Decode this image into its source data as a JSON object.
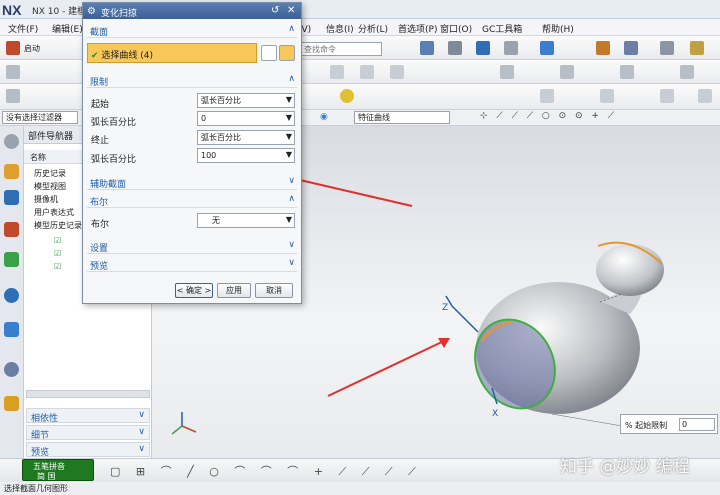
{
  "app": {
    "logo": "NX",
    "title": "NX 10 - 建模"
  },
  "menu": [
    "文件(F)",
    "编辑(E)",
    "视图(V)",
    "信息(I)",
    "分析(L)",
    "首选项(P)",
    "窗口(O)",
    "GC工具箱",
    "帮助(H)"
  ],
  "toolbar": {
    "start_label": "启动",
    "command_search_placeholder": "查找命令"
  },
  "filter": {
    "selection_filter": "没有选择过滤器",
    "curve_rule": "特征曲线"
  },
  "navigator": {
    "title": "部件导航器",
    "column": "名称",
    "rows": [
      "历史记录",
      "模型视图",
      "摄像机",
      "用户表达式",
      "模型历史记录"
    ],
    "sections": [
      "相依性",
      "细节",
      "预览"
    ]
  },
  "dialog": {
    "title": "变化扫掠",
    "section_label": "截面",
    "select_curve": "选择曲线 (4)",
    "limits_label": "限制",
    "start_label": "起始",
    "start_type": "弧长百分比",
    "start_pct_label": "弧长百分比",
    "start_pct_value": "0",
    "end_label": "终止",
    "end_type": "弧长百分比",
    "end_pct_label": "弧长百分比",
    "end_pct_value": "100",
    "aux_label": "辅助截面",
    "boolean_label": "布尔",
    "boolean_field_label": "布尔",
    "boolean_value": "无",
    "settings_label": "设置",
    "preview_label": "预览",
    "ok": "< 确定 >",
    "apply": "应用",
    "cancel": "取消"
  },
  "viewport": {
    "limit_label": "% 起始限制",
    "limit_value": "0"
  },
  "bottom": {
    "ime_label": "五笔拼音",
    "ime_mode": "简 国"
  },
  "status": "选择截面几何图形",
  "watermark": "知乎 @妙妙 编程",
  "colors": {
    "accent": "#1f5fa8",
    "highlight": "#f7c75a",
    "title": "#3c5f95"
  }
}
